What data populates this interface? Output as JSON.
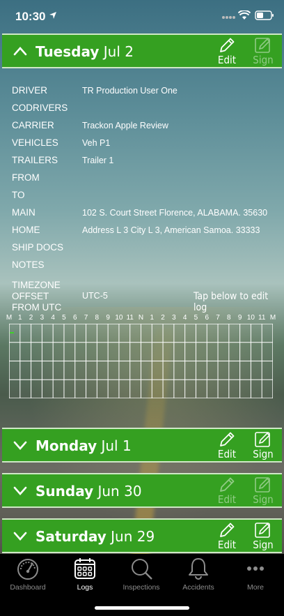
{
  "status_bar": {
    "time": "10:30"
  },
  "expanded_day": {
    "weekday": "Tuesday",
    "date": "Jul 2",
    "edit_label": "Edit",
    "sign_label": "Sign",
    "details": [
      {
        "label": "DRIVER",
        "value": "TR Production User One"
      },
      {
        "label": "CODRIVERS",
        "value": ""
      },
      {
        "label": "CARRIER",
        "value": "Trackon Apple Review"
      },
      {
        "label": "VEHICLES",
        "value": "Veh P1"
      },
      {
        "label": "TRAILERS",
        "value": "Trailer 1"
      },
      {
        "label": "FROM",
        "value": ""
      },
      {
        "label": "TO",
        "value": ""
      },
      {
        "label": "MAIN",
        "value": "102 S. Court Street Florence, ALABAMA. 35630"
      },
      {
        "label": "HOME",
        "value": "Address L 3 City L 3, American Samoa. 33333"
      },
      {
        "label": "SHIP DOCS",
        "value": ""
      },
      {
        "label": "NOTES",
        "value": ""
      }
    ],
    "timezone_label_1": "TIMEZONE",
    "timezone_label_2": "OFFSET",
    "timezone_label_3": "FROM UTC",
    "timezone_value": "UTC-5",
    "tap_hint": "Tap below to edit log",
    "hour_labels": [
      "M",
      "1",
      "2",
      "3",
      "4",
      "5",
      "6",
      "7",
      "8",
      "9",
      "10",
      "11",
      "N",
      "1",
      "2",
      "3",
      "4",
      "5",
      "6",
      "7",
      "8",
      "9",
      "10",
      "11",
      "M"
    ]
  },
  "collapsed_days": [
    {
      "weekday": "Monday",
      "date": "Jul 1",
      "edit_label": "Edit",
      "sign_label": "Sign",
      "edit_enabled": true,
      "sign_enabled": true
    },
    {
      "weekday": "Sunday",
      "date": "Jun 30",
      "edit_label": "Edit",
      "sign_label": "Sign",
      "edit_enabled": false,
      "sign_enabled": false
    },
    {
      "weekday": "Saturday",
      "date": "Jun 29",
      "edit_label": "Edit",
      "sign_label": "Sign",
      "edit_enabled": true,
      "sign_enabled": true
    }
  ],
  "tabs": [
    {
      "label": "Dashboard",
      "icon": "dashboard-gauge-icon",
      "active": false
    },
    {
      "label": "Logs",
      "icon": "calendar-icon",
      "active": true
    },
    {
      "label": "Inspections",
      "icon": "magnifier-icon",
      "active": false
    },
    {
      "label": "Accidents",
      "icon": "bell-icon",
      "active": false
    },
    {
      "label": "More",
      "icon": "more-dots-icon",
      "active": false
    }
  ],
  "colors": {
    "header_green": "#35a021",
    "header_border": "#cfe8c6",
    "tab_bar": "#000000",
    "tab_inactive": "#8c8c8c",
    "tab_active": "#ffffff"
  }
}
